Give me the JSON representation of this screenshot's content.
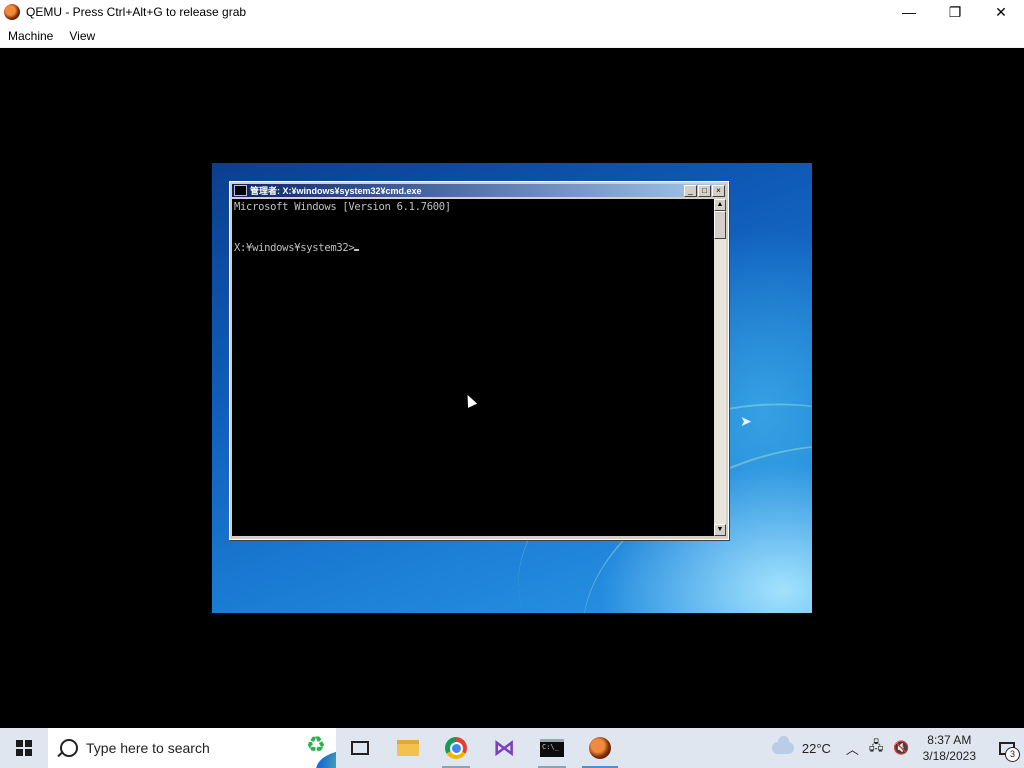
{
  "window": {
    "title": "QEMU - Press Ctrl+Alt+G to release grab",
    "minimize_glyph": "—",
    "maximize_glyph": "❐",
    "close_glyph": "✕"
  },
  "menubar": {
    "items": [
      {
        "label": "Machine"
      },
      {
        "label": "View"
      }
    ]
  },
  "guest": {
    "cmd_window": {
      "title": "管理者: X:¥windows¥system32¥cmd.exe",
      "lines": [
        "Microsoft Windows [Version 6.1.7600]",
        "",
        "X:¥windows¥system32>"
      ],
      "buttons": {
        "minimize": "_",
        "maximize": "□",
        "close": "×"
      }
    }
  },
  "taskbar": {
    "search_placeholder": "Type here to search",
    "pinned": [
      {
        "name": "task-view",
        "icon": "task-view-icon"
      },
      {
        "name": "file-explorer",
        "icon": "folder-icon"
      },
      {
        "name": "chrome",
        "icon": "chrome-icon"
      },
      {
        "name": "visual-studio",
        "icon": "visual-studio-icon"
      },
      {
        "name": "terminal",
        "icon": "terminal-icon"
      },
      {
        "name": "qemu",
        "icon": "qemu-icon"
      }
    ],
    "weather": {
      "temp": "22°C",
      "icon": "cloudy-icon"
    },
    "clock": {
      "time": "8:37 AM",
      "date": "3/18/2023"
    },
    "notifications": {
      "count": "3"
    }
  }
}
